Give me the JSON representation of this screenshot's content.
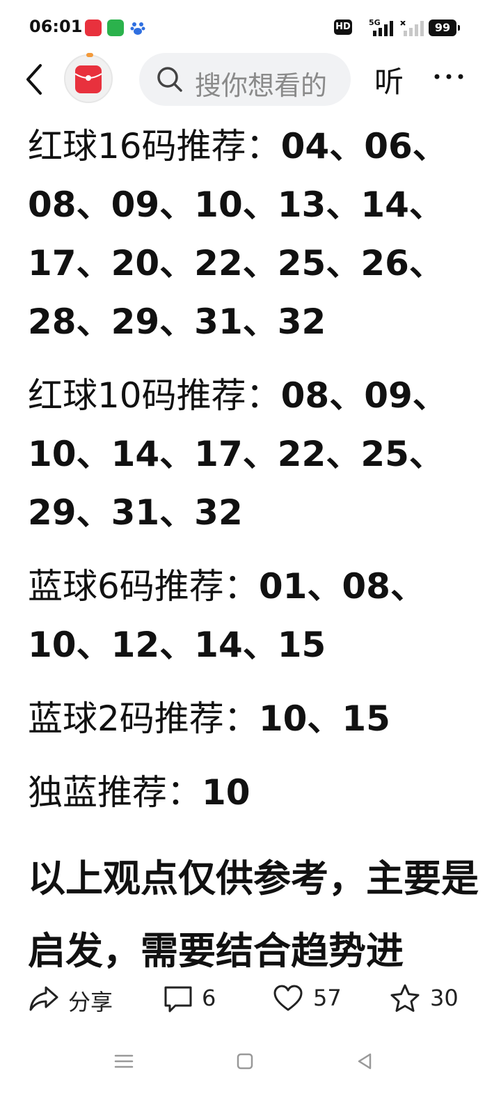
{
  "status": {
    "time": "06:01",
    "hd": "HD",
    "network": "5G",
    "battery": "99"
  },
  "header": {
    "search_placeholder": "搜你想看的",
    "listen_label": "听"
  },
  "article": {
    "paragraphs": [
      {
        "label": "红球16码推荐：",
        "numbers": "04、06、08、09、10、13、14、17、20、22、25、26、28、29、31、32"
      },
      {
        "label": "红球10码推荐：",
        "numbers": "08、09、10、14、17、22、25、29、31、32"
      },
      {
        "label": "蓝球6码推荐：",
        "numbers": "01、08、10、12、14、15"
      },
      {
        "label": "蓝球2码推荐：",
        "numbers": "10、15"
      },
      {
        "label": "独蓝推荐：",
        "numbers": "10"
      }
    ],
    "note": "以上观点仅供参考，主要是启发，需要结合趋势进"
  },
  "actions": {
    "share_label": "分享",
    "comments_count": "6",
    "likes_count": "57",
    "favorites_count": "30"
  }
}
